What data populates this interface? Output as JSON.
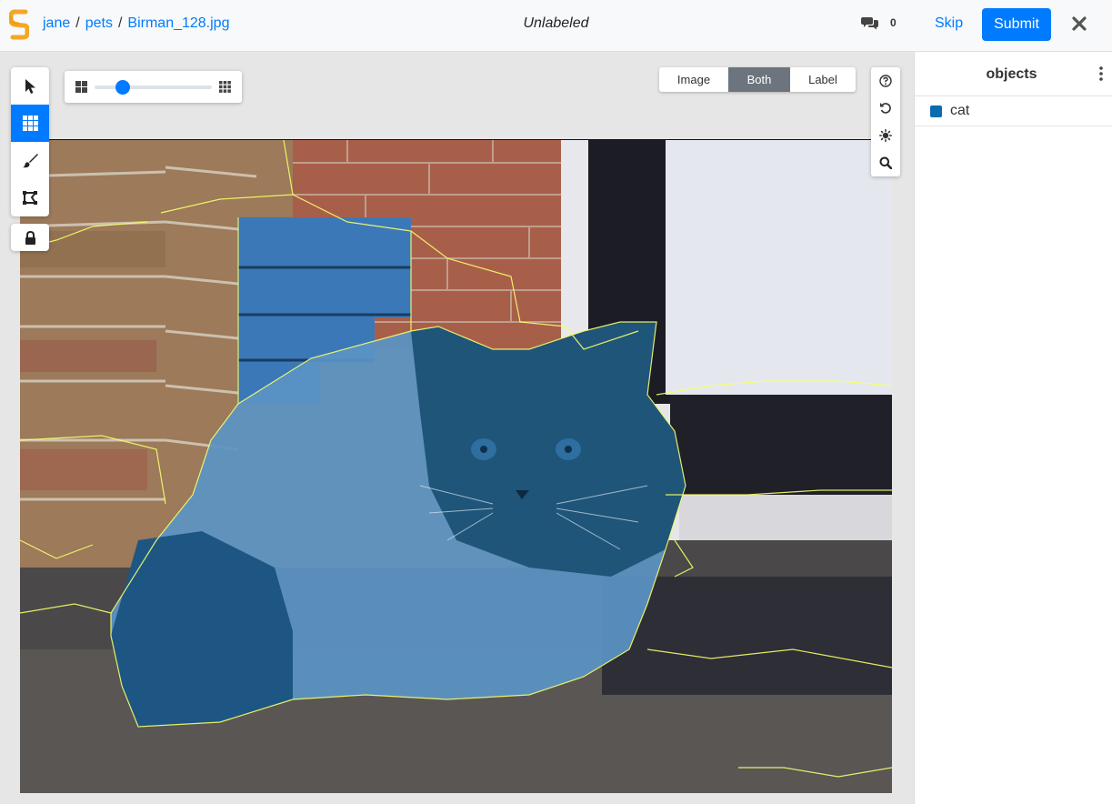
{
  "header": {
    "breadcrumb": [
      "jane",
      "pets",
      "Birman_128.jpg"
    ],
    "separator": "/",
    "status_title": "Unlabeled",
    "comment_count": "0",
    "skip_label": "Skip",
    "submit_label": "Submit"
  },
  "view_toggle": {
    "options": [
      "Image",
      "Both",
      "Label"
    ],
    "active": "Both"
  },
  "toolbar": {
    "tools": [
      "select-tool",
      "superpixel-tool",
      "brush-tool",
      "polygon-tool"
    ],
    "active_tool": "superpixel-tool",
    "lock": "lock-icon"
  },
  "superpixel_slider": {
    "value": 0.2
  },
  "sidebar": {
    "title": "objects",
    "objects": [
      {
        "label": "cat",
        "color": "#0b6bb0"
      }
    ]
  },
  "colors": {
    "accent": "#007bff",
    "overlay": "#0b5d97",
    "segment_outline": "#f6ff6a"
  }
}
